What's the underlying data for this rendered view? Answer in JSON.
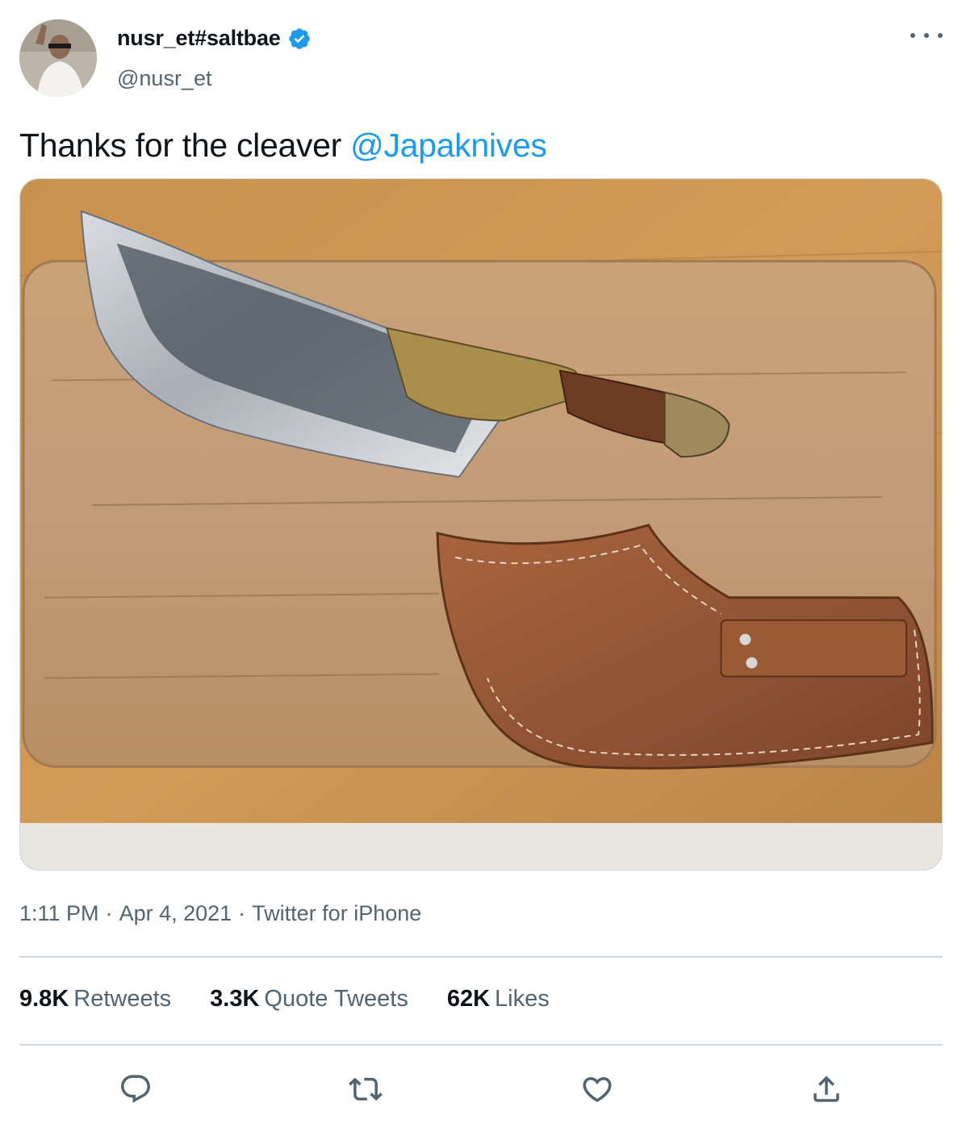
{
  "author": {
    "display_name": "nusr_et#saltbae",
    "handle": "@nusr_et",
    "verified_icon": "verified-badge-icon",
    "avatar_alt": "profile photo"
  },
  "tweet": {
    "text": "Thanks for the cleaver ",
    "mention": "@Japaknives"
  },
  "meta": {
    "time": "1:11 PM",
    "date": "Apr 4, 2021",
    "source": "Twitter for iPhone",
    "separator": "·"
  },
  "stats": {
    "retweets_count": "9.8K",
    "retweets_label": "Retweets",
    "quotes_count": "3.3K",
    "quotes_label": "Quote Tweets",
    "likes_count": "62K",
    "likes_label": "Likes"
  },
  "actions": [
    "reply-icon",
    "retweet-icon",
    "like-icon",
    "share-icon"
  ],
  "colors": {
    "link": "#1d9bf0",
    "secondary_text": "#536471",
    "divider": "#cfd9de"
  }
}
